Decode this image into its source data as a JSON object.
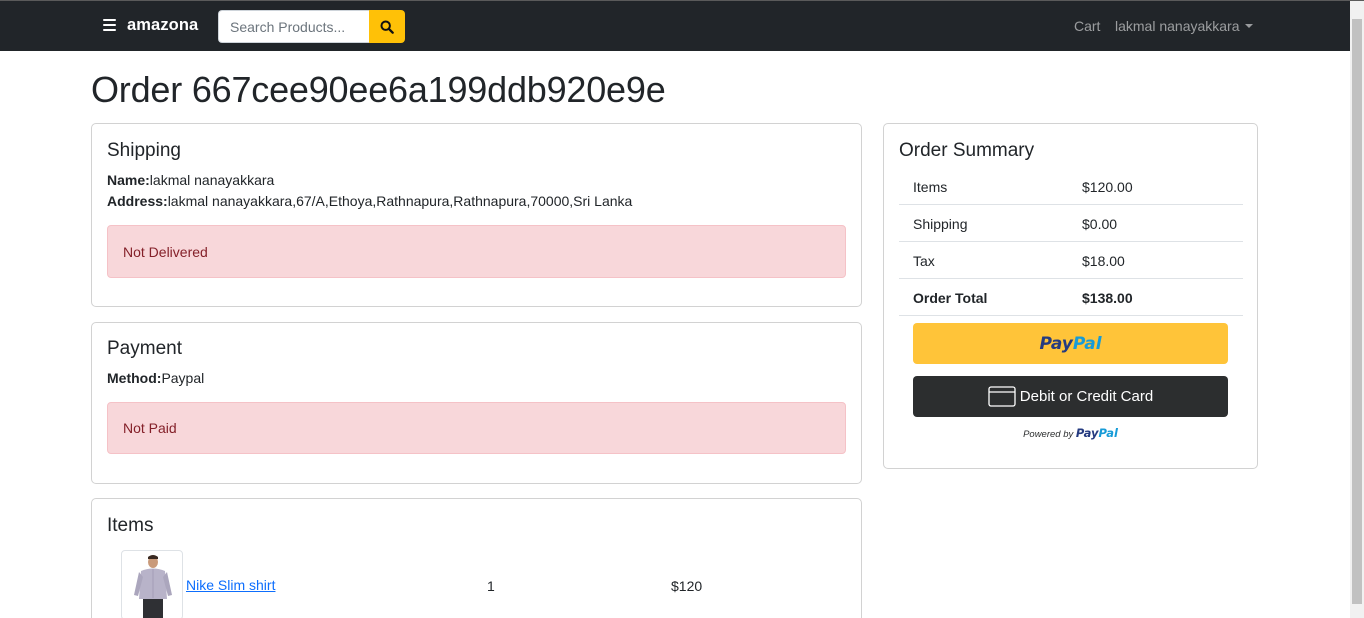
{
  "navbar": {
    "brand": "amazona",
    "search_placeholder": "Search Products...",
    "cart_label": "Cart",
    "user_label": "lakmal nanayakkara"
  },
  "page": {
    "title": "Order 667cee90ee6a199ddb920e9e"
  },
  "shipping": {
    "title": "Shipping",
    "name_label": "Name:",
    "name_value": "lakmal nanayakkara",
    "address_label": "Address:",
    "address_value": "lakmal nanayakkara,67/A,Ethoya,Rathnapura,Rathnapura,70000,Sri Lanka",
    "status": "Not Delivered"
  },
  "payment": {
    "title": "Payment",
    "method_label": "Method:",
    "method_value": "Paypal",
    "status": "Not Paid"
  },
  "items": {
    "title": "Items",
    "rows": [
      {
        "name": "Nike Slim shirt",
        "quantity": "1",
        "price": "$120"
      }
    ]
  },
  "summary": {
    "title": "Order Summary",
    "rows": [
      {
        "label": "Items",
        "value": "$120.00"
      },
      {
        "label": "Shipping",
        "value": "$0.00"
      },
      {
        "label": "Tax",
        "value": "$18.00"
      },
      {
        "label": "Order Total",
        "value": "$138.00"
      }
    ],
    "paypal_part1": "Pay",
    "paypal_part2": "Pal",
    "card_button": "Debit or Credit Card",
    "powered_by": "Powered by",
    "powered_brand_1": "Pay",
    "powered_brand_2": "Pal"
  },
  "colors": {
    "navbar": "#212529",
    "search_button": "#ffc107",
    "alert_bg": "#f8d7da",
    "alert_text": "#842029",
    "paypal_yellow": "#ffc439",
    "card_button": "#2c2e2f",
    "link": "#0d6efd"
  },
  "icons": {
    "menu": "hamburger-icon",
    "search": "magnifier-icon",
    "user_dropdown": "caret-down-icon",
    "card": "credit-card-icon"
  }
}
